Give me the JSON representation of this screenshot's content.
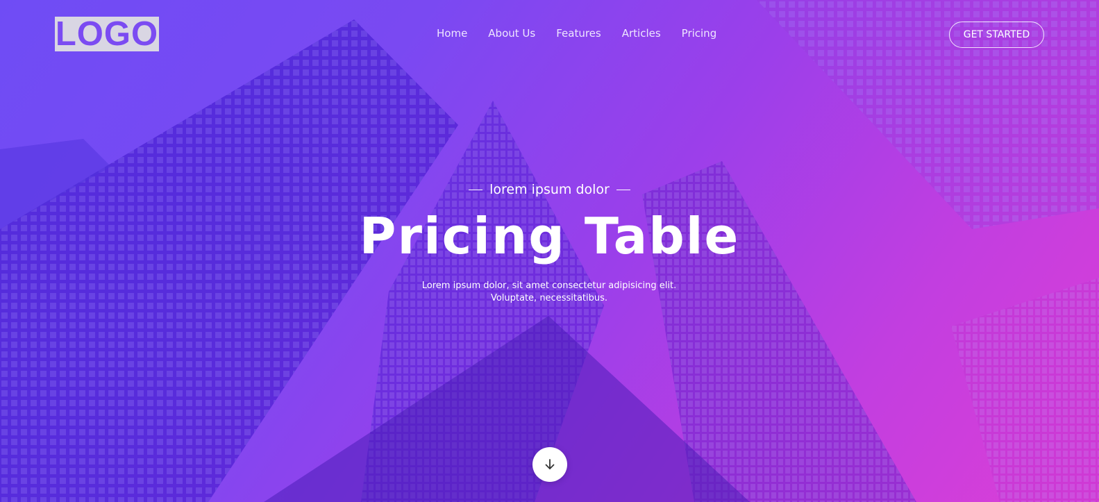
{
  "header": {
    "logo_text": "LOGO",
    "nav": [
      {
        "label": "Home"
      },
      {
        "label": "About Us"
      },
      {
        "label": "Features"
      },
      {
        "label": "Articles"
      },
      {
        "label": "Pricing"
      }
    ],
    "cta_label": "GET STARTED"
  },
  "hero": {
    "kicker": "lorem ipsum dolor",
    "title": "Pricing Table",
    "subtitle_line1": "Lorem ipsum dolor, sit amet consectetur adipisicing elit.",
    "subtitle_line2": "Voluptate, necessitatibus.",
    "scroll_icon": "arrow-down-icon"
  },
  "colors": {
    "gradient_start": "#6f4cf5",
    "gradient_end": "#dc3fd6",
    "logo_bg": "#d9d6e3",
    "logo_text": "#7b4bf2"
  }
}
